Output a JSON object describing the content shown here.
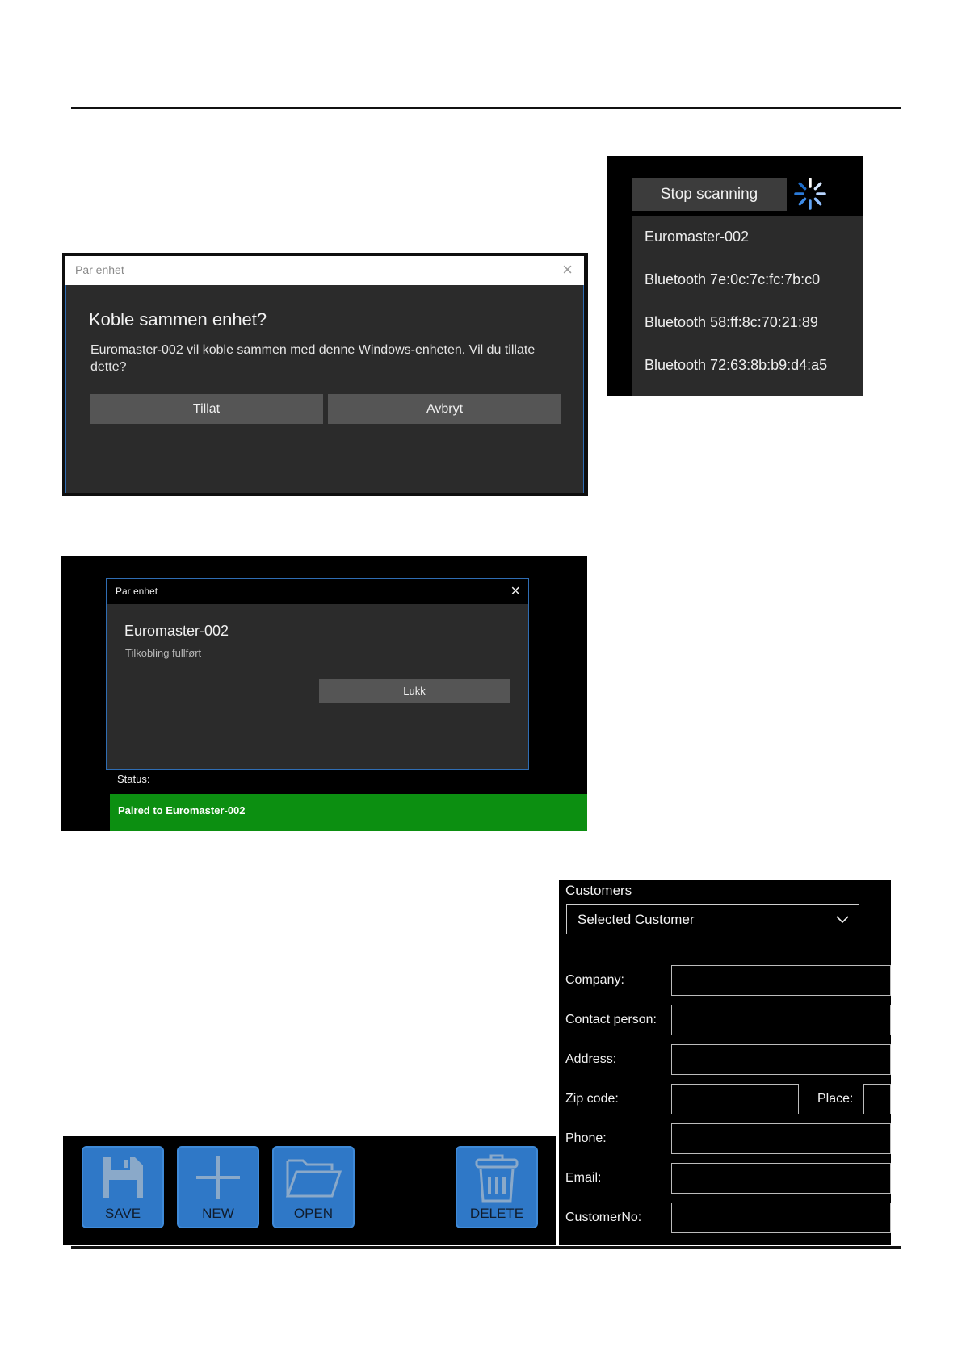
{
  "pair_dialog": {
    "title": "Par enhet",
    "close_glyph": "×",
    "heading": "Koble sammen enhet?",
    "message": "Euromaster-002 vil koble sammen med denne Windows-enheten. Vil du tillate dette?",
    "allow_label": "Tillat",
    "cancel_label": "Avbryt"
  },
  "scanning": {
    "stop_label": "Stop scanning",
    "spinner_icon": "loading-spinner-icon",
    "devices": [
      "Euromaster-002",
      "Bluetooth 7e:0c:7c:fc:7b:c0",
      "Bluetooth 58:ff:8c:70:21:89",
      "Bluetooth 72:63:8b:b9:d4:a5"
    ]
  },
  "paired_dialog": {
    "title": "Par enhet",
    "close_glyph": "×",
    "device_name": "Euromaster-002",
    "subtitle": "Tilkobling fullført",
    "close_label": "Lukk",
    "status_label": "Status:",
    "status_text": "Paired to Euromaster-002",
    "status_color": "#0c8f11"
  },
  "toolbar": {
    "save_label": "SAVE",
    "new_label": "NEW",
    "open_label": "OPEN",
    "delete_label": "DELETE",
    "button_color": "#2f78c7"
  },
  "customers": {
    "header": "Customers",
    "selected": "Selected Customer",
    "fields": {
      "company": "Company:",
      "contact": "Contact person:",
      "address": "Address:",
      "zip": "Zip code:",
      "place": "Place:",
      "phone": "Phone:",
      "email": "Email:",
      "customer_no": "CustomerNo:"
    }
  }
}
